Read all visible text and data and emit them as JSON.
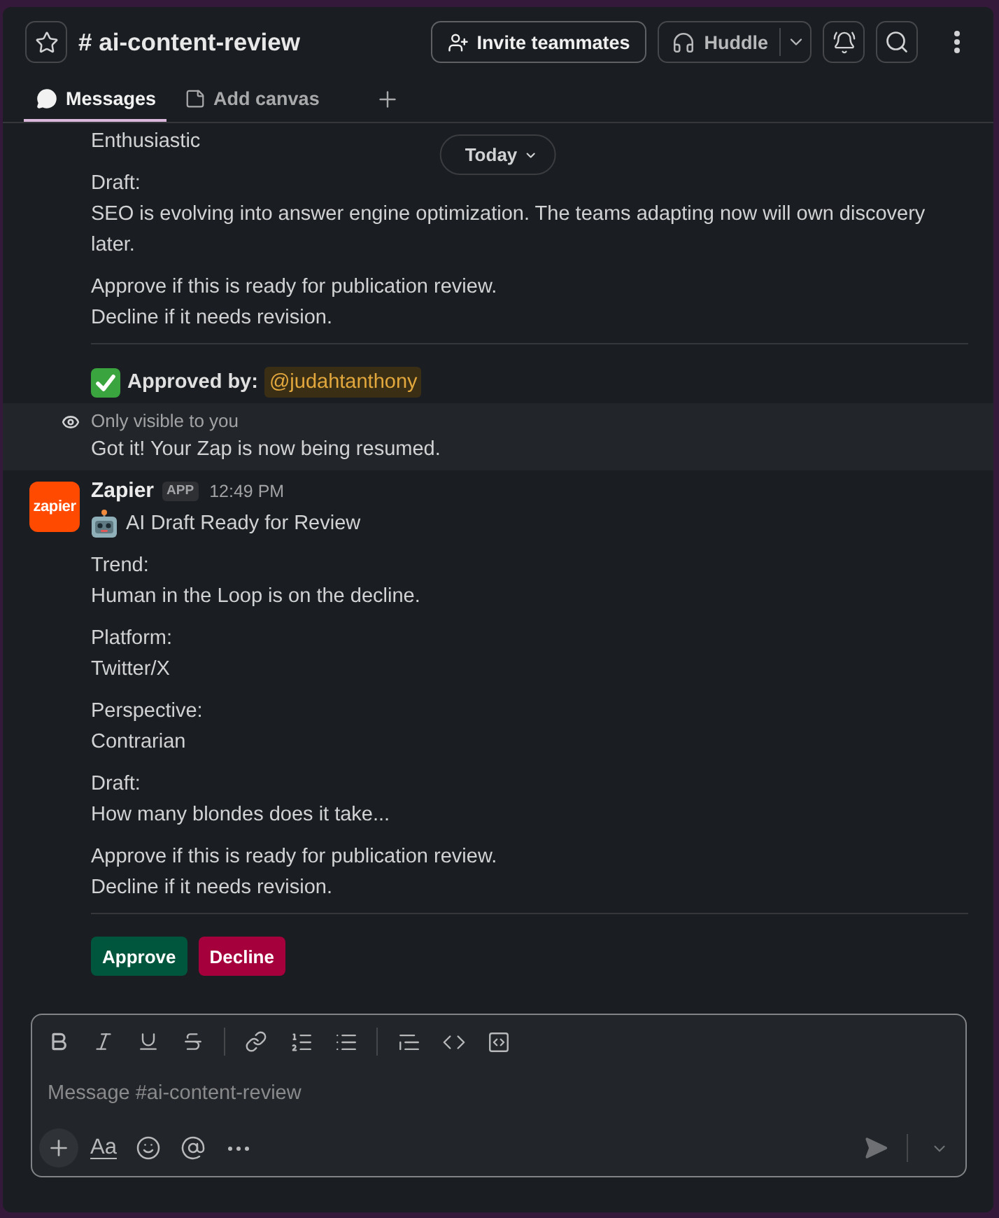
{
  "header": {
    "title": "# ai-content-review",
    "invite_button": "Invite teammates",
    "huddle_button": "Huddle"
  },
  "tabs": [
    {
      "label": "Messages",
      "kind": "messages",
      "selected": true
    },
    {
      "label": "Add canvas",
      "kind": "canvas",
      "selected": false
    }
  ],
  "date_divider": "Today",
  "earlier_message": {
    "fields": [
      {
        "value": "Enthusiastic"
      },
      {
        "label": "Draft:",
        "value": "SEO is evolving into answer engine optimization. The teams adapting now will own discovery later."
      }
    ],
    "instructions": [
      "Approve if this is ready for publication review.",
      "Decline if it needs revision."
    ],
    "approval": {
      "label": "Approved by:",
      "mention": "@judahtanthony"
    }
  },
  "ephemeral_notice": {
    "note": "Only visible to you",
    "text": "Got it! Your Zap is now being resumed."
  },
  "message": {
    "avatar_text": "zapier",
    "sender": "Zapier",
    "badge": "APP",
    "time": "12:49 PM",
    "title": "AI Draft Ready for Review",
    "fields": [
      {
        "label": "Trend:",
        "value": "Human in the Loop is on the decline."
      },
      {
        "label": "Platform:",
        "value": "Twitter/X"
      },
      {
        "label": "Perspective:",
        "value": "Contrarian"
      },
      {
        "label": "Draft:",
        "value": "How many blondes does it take..."
      }
    ],
    "instructions": [
      "Approve if this is ready for publication review.",
      "Decline if it needs revision."
    ],
    "buttons": [
      {
        "label": "Approve",
        "kind": "approve"
      },
      {
        "label": "Decline",
        "kind": "decline"
      }
    ]
  },
  "composer": {
    "placeholder": "Message #ai-content-review",
    "format_toggle": "Aa"
  }
}
